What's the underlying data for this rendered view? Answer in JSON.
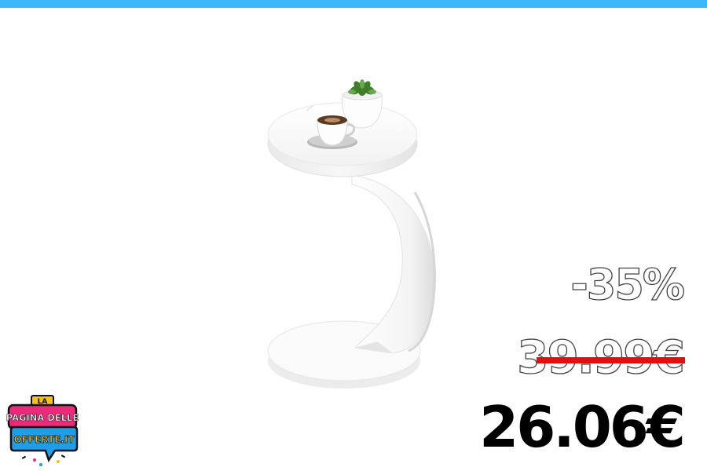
{
  "colors": {
    "top_bar": "#3db7f7",
    "strike": "#e01010",
    "price_new": "#000000"
  },
  "product": {
    "image_icon": "side-table-product-image"
  },
  "pricing": {
    "discount": "-35%",
    "old_price": "39.99€",
    "new_price": "26.06€"
  },
  "logo": {
    "text_la": "LA",
    "text_line1": "PAGINA DELLE",
    "text_line2": "OFFERTE.IT"
  }
}
